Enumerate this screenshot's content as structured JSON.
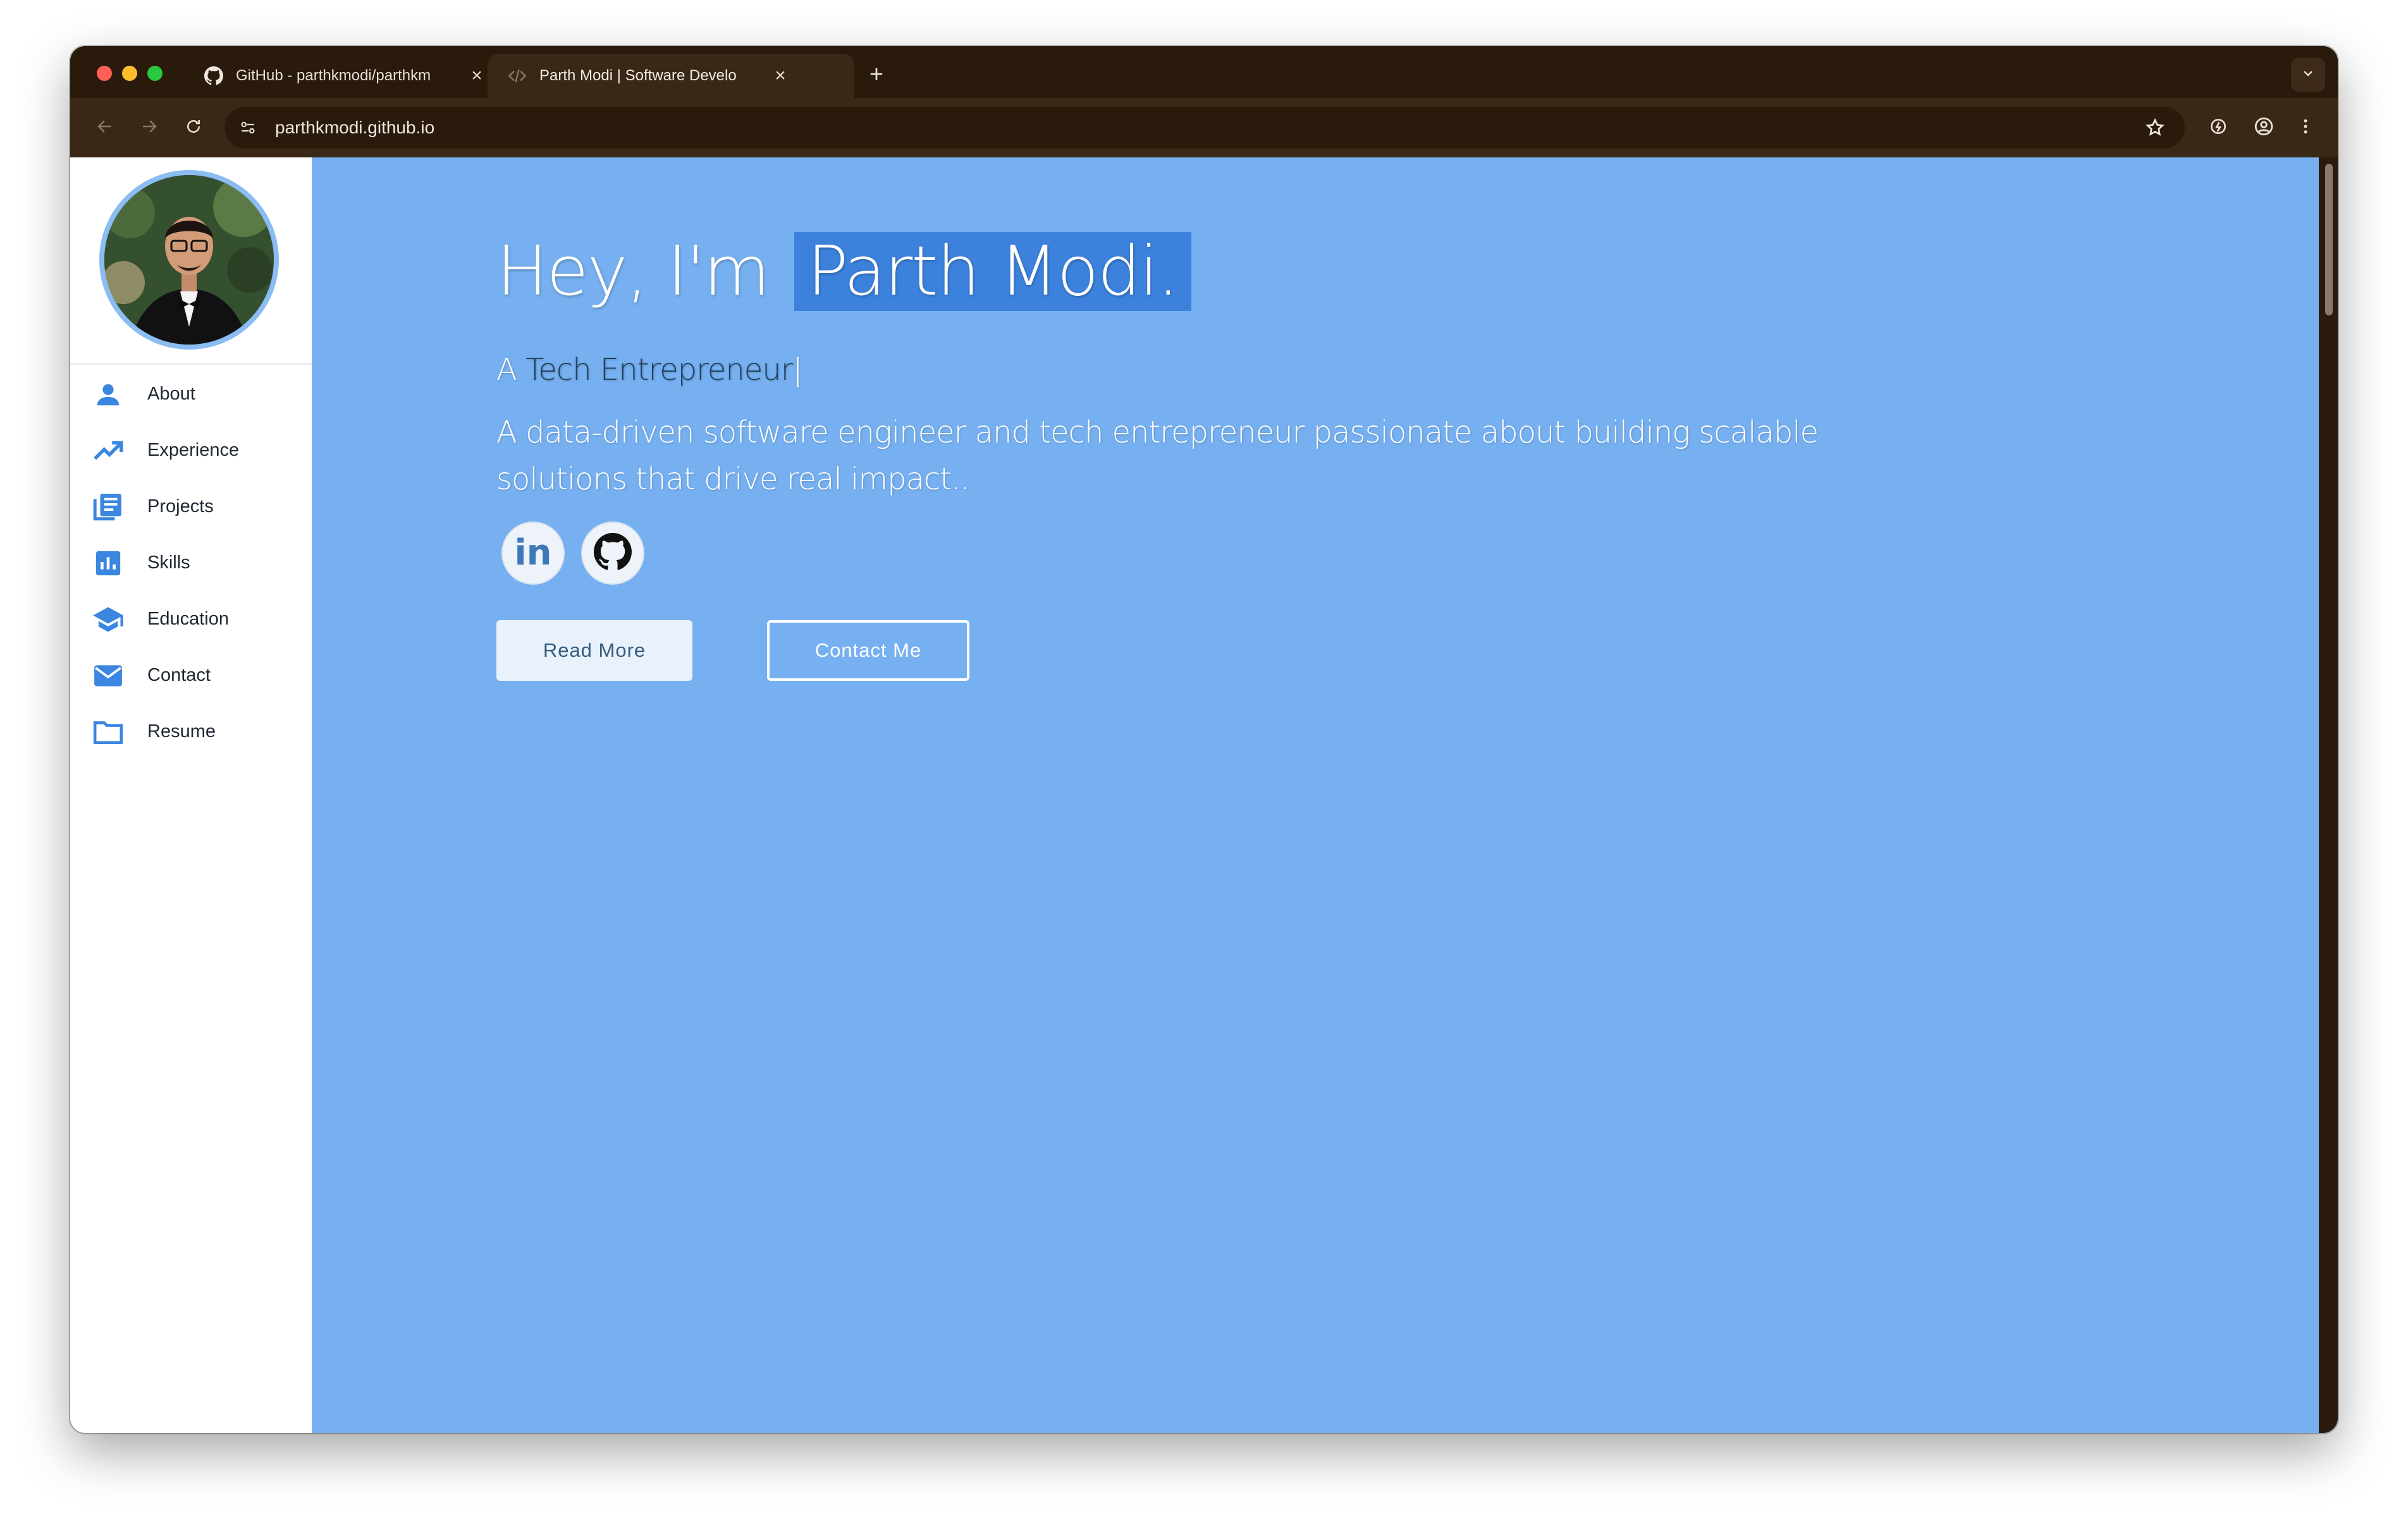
{
  "browser": {
    "tabs": [
      {
        "title": "GitHub - parthkmodi/parthkm",
        "icon": "github-icon",
        "active": false
      },
      {
        "title": "Parth Modi | Software Develo",
        "icon": "code-icon",
        "active": true
      }
    ],
    "close_glyph": "×",
    "new_tab_glyph": "+",
    "url": "parthkmodi.github.io"
  },
  "sidebar": {
    "items": [
      {
        "label": "About",
        "icon": "person-icon"
      },
      {
        "label": "Experience",
        "icon": "trending-up-icon"
      },
      {
        "label": "Projects",
        "icon": "newspaper-icon"
      },
      {
        "label": "Skills",
        "icon": "bar-chart-icon"
      },
      {
        "label": "Education",
        "icon": "graduation-cap-icon"
      },
      {
        "label": "Contact",
        "icon": "envelope-icon"
      },
      {
        "label": "Resume",
        "icon": "folder-icon"
      }
    ]
  },
  "hero": {
    "greeting": "Hey, I'm",
    "name": "Parth Modi.",
    "tagline_prefix": "A",
    "tagline_typed": "Tech Entrepreneur",
    "caret": "|",
    "description": "A data-driven software engineer and tech entrepreneur passionate about building scalable solutions that drive real impact..",
    "social": [
      {
        "name": "linkedin-icon",
        "glyph": "in"
      },
      {
        "name": "github-icon"
      }
    ],
    "read_more_label": "Read More",
    "contact_label": "Contact Me"
  },
  "colors": {
    "accent": "#3c82dc",
    "hero_bg": "#76b0f0",
    "icon_blue": "#3a86e0"
  }
}
